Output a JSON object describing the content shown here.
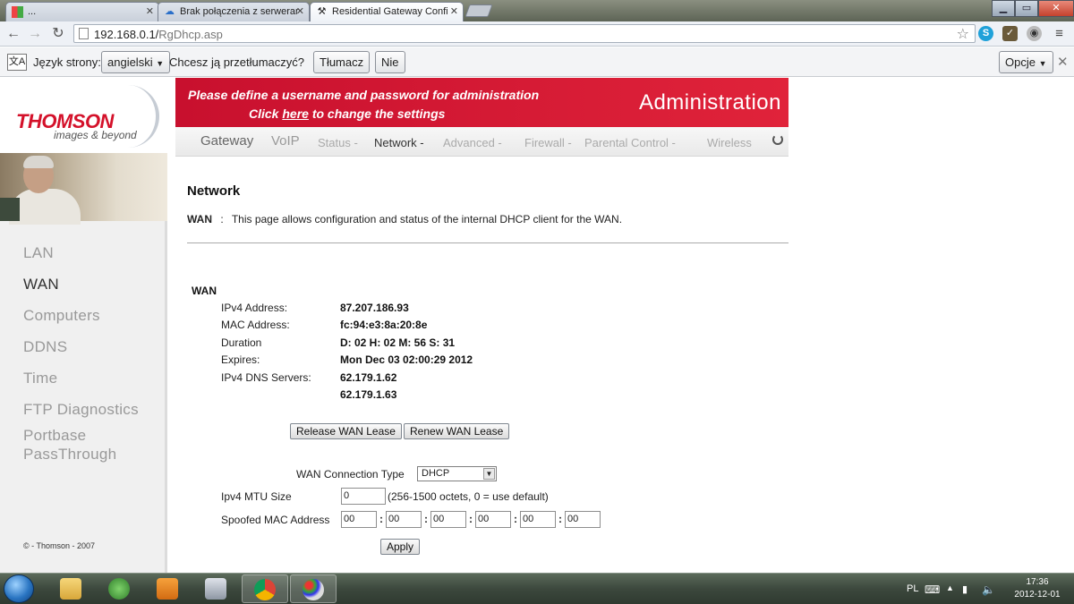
{
  "browser": {
    "tabs": [
      {
        "title": "...",
        "active": false
      },
      {
        "title": "Brak połączenia z serwerar",
        "active": false
      },
      {
        "title": "Residential Gateway Confi",
        "active": true
      }
    ],
    "url_host": "192.168.0.1/",
    "url_path": "RgDhcp.asp"
  },
  "translate_bar": {
    "page_language_label": "Język strony:",
    "language_value": "angielski",
    "question": "Chcesz ją przetłumaczyć?",
    "translate_button": "Tłumacz",
    "no_button": "Nie",
    "options_button": "Opcje"
  },
  "header": {
    "logo": "THOMSON",
    "logo_tagline": "images & beyond",
    "notice_line1": "Please define a username and password for administration",
    "notice_click": "Click",
    "notice_here": "here",
    "notice_rest": "to change the settings",
    "section_title": "Administration"
  },
  "nav": {
    "items": [
      "Gateway",
      "VoIP",
      "Status -",
      "Network -",
      "Advanced -",
      "Firewall -",
      "Parental Control -",
      "Wireless"
    ],
    "active": "Network -"
  },
  "sidebar": {
    "items": [
      "LAN",
      "WAN",
      "Computers",
      "DDNS",
      "Time",
      "FTP Diagnostics",
      "Portbase",
      "PassThrough"
    ],
    "active": "WAN",
    "copyright": "© - Thomson - 2007"
  },
  "content": {
    "heading": "Network",
    "desc_key": "WAN",
    "desc_sep": ":",
    "desc_text": "This page allows configuration and status of the internal DHCP client for the WAN.",
    "section": "WAN",
    "rows": [
      {
        "label": "IPv4 Address:",
        "value": "87.207.186.93"
      },
      {
        "label": "MAC Address:",
        "value": "fc:94:e3:8a:20:8e"
      },
      {
        "label": "Duration",
        "value": "D: 02 H: 02 M: 56 S: 31"
      },
      {
        "label": "Expires:",
        "value": "Mon Dec 03 02:00:29 2012"
      },
      {
        "label": "IPv4 DNS Servers:",
        "value": "62.179.1.62"
      },
      {
        "label": "",
        "value": "62.179.1.63"
      }
    ],
    "release_button": "Release WAN Lease",
    "renew_button": "Renew WAN Lease",
    "connection_type_label": "WAN Connection Type",
    "connection_type_value": "DHCP",
    "mtu_label": "Ipv4 MTU Size",
    "mtu_value": "0",
    "mtu_hint": "(256-1500 octets, 0 = use default)",
    "mac_label": "Spoofed MAC Address",
    "mac_octets": [
      "00",
      "00",
      "00",
      "00",
      "00",
      "00"
    ],
    "apply_button": "Apply"
  },
  "taskbar": {
    "language": "PL",
    "time": "17:36",
    "date": "2012-12-01"
  }
}
